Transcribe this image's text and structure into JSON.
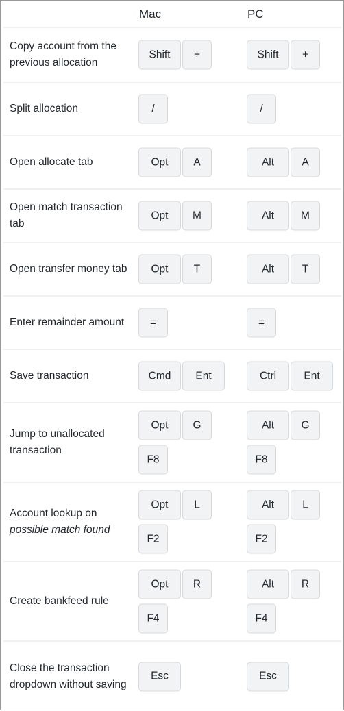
{
  "header": {
    "mac": "Mac",
    "pc": "PC"
  },
  "rows": [
    {
      "desc": "Copy account from the previous allocation",
      "mac": [
        [
          "Shift",
          "+"
        ]
      ],
      "pc": [
        [
          "Shift",
          "+"
        ]
      ]
    },
    {
      "desc": "Split allocation",
      "mac": [
        [
          "/"
        ]
      ],
      "pc": [
        [
          "/"
        ]
      ]
    },
    {
      "desc": "Open allocate tab",
      "mac": [
        [
          "Opt",
          "A"
        ]
      ],
      "pc": [
        [
          "Alt",
          "A"
        ]
      ]
    },
    {
      "desc": "Open match transaction tab",
      "mac": [
        [
          "Opt",
          "M"
        ]
      ],
      "pc": [
        [
          "Alt",
          "M"
        ]
      ]
    },
    {
      "desc": "Open transfer money tab",
      "mac": [
        [
          "Opt",
          "T"
        ]
      ],
      "pc": [
        [
          "Alt",
          "T"
        ]
      ]
    },
    {
      "desc": "Enter remainder amount",
      "mac": [
        [
          "="
        ]
      ],
      "pc": [
        [
          "="
        ]
      ]
    },
    {
      "desc": "Save transaction",
      "mac": [
        [
          "Cmd",
          "Ent"
        ]
      ],
      "pc": [
        [
          "Ctrl",
          "Ent"
        ]
      ]
    },
    {
      "desc": "Jump to unallocated transaction",
      "mac": [
        [
          "Opt",
          "G"
        ],
        [
          "F8"
        ]
      ],
      "pc": [
        [
          "Alt",
          "G"
        ],
        [
          "F8"
        ]
      ]
    },
    {
      "desc": "Account lookup on",
      "desc_em": "possible match found",
      "mac": [
        [
          "Opt",
          "L"
        ],
        [
          "F2"
        ]
      ],
      "pc": [
        [
          "Alt",
          "L"
        ],
        [
          "F2"
        ]
      ]
    },
    {
      "desc": "Create bankfeed rule",
      "mac": [
        [
          "Opt",
          "R"
        ],
        [
          "F4"
        ]
      ],
      "pc": [
        [
          "Alt",
          "R"
        ],
        [
          "F4"
        ]
      ]
    },
    {
      "desc": "Close the transaction dropdown without saving",
      "mac": [
        [
          "Esc"
        ]
      ],
      "pc": [
        [
          "Esc"
        ]
      ]
    }
  ]
}
